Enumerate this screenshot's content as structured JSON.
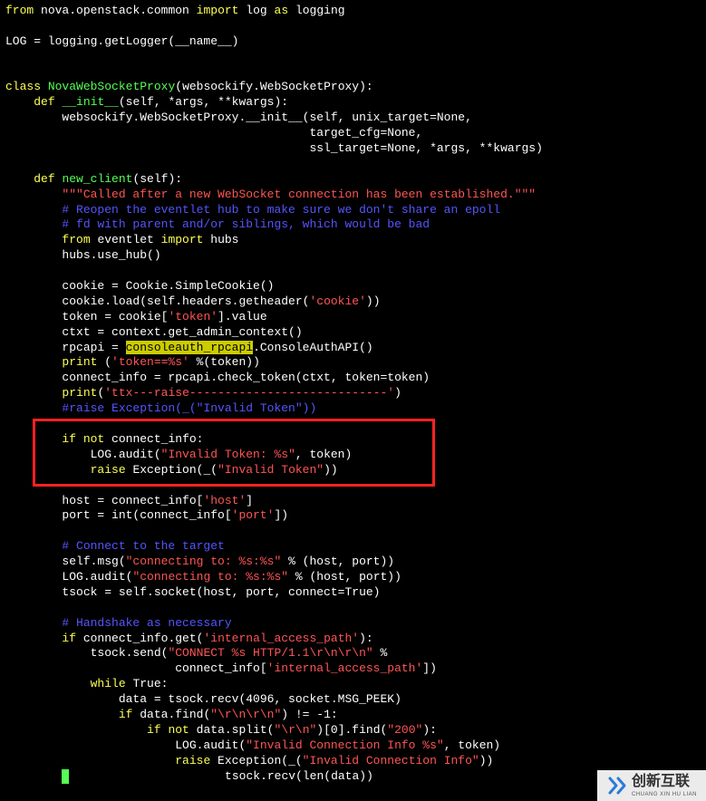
{
  "code": {
    "l1_from": "from",
    "l1_mod": "nova.openstack.common",
    "l1_import": "import",
    "l1_log": "log",
    "l1_as": "as",
    "l1_alias": "logging",
    "l3": "LOG = logging.getLogger(__name__)",
    "l6_class": "class",
    "l6_name": "NovaWebSocketProxy",
    "l6_rest": "(websockify.WebSocketProxy):",
    "l7_def": "def",
    "l7_name": "__init__",
    "l7_rest": "(self, *args, **kwargs):",
    "l8a": "        websockify.WebSocketProxy.__init__(self, unix_target=None,",
    "l8b": "                                           target_cfg=None,",
    "l8c": "                                           ssl_target=None, *args, **kwargs)",
    "l11_def": "def",
    "l11_name": "new_client",
    "l11_rest": "(self):",
    "l12_pre": "        ",
    "l12_doc": "\"\"\"Called after a new WebSocket connection has been established.\"\"\"",
    "l13": "        # Reopen the eventlet hub to make sure we don't share an epoll",
    "l14": "        # fd with parent and/or siblings, which would be bad",
    "l15_pre": "        ",
    "l15_from": "from",
    "l15_mod": " eventlet ",
    "l15_import": "import",
    "l15_rest": " hubs",
    "l16": "        hubs.use_hub()",
    "l18": "        cookie = Cookie.SimpleCookie()",
    "l19a": "        cookie.load(self.headers.getheader(",
    "l19s": "'cookie'",
    "l19b": "))",
    "l20a": "        token = cookie[",
    "l20s": "'token'",
    "l20b": "].value",
    "l21": "        ctxt = context.get_admin_context()",
    "l22a": "        rpcapi = ",
    "l22hl": "consoleauth_rpcapi",
    "l22b": ".ConsoleAuthAPI()",
    "l23_pre": "        ",
    "l23_print": "print",
    "l23a": " (",
    "l23s": "'token==%s'",
    "l23b": " %(token))",
    "l24": "        connect_info = rpcapi.check_token(ctxt, token=token)",
    "l25_pre": "        ",
    "l25_print": "print",
    "l25a": "(",
    "l25s": "'ttx---raise----------------------------'",
    "l25b": ")",
    "l26": "        #raise Exception(_(\"Invalid Token\"))",
    "l28_pre": "        ",
    "l28_if": "if",
    "l28_not": " not",
    "l28_rest": " connect_info:",
    "l29a": "            LOG.audit(",
    "l29s": "\"Invalid Token: %s\"",
    "l29b": ", token)",
    "l30_pre": "            ",
    "l30_raise": "raise",
    "l30a": " Exception(_(",
    "l30s": "\"Invalid Token\"",
    "l30b": "))",
    "l32a": "        host = connect_info[",
    "l32s": "'host'",
    "l32b": "]",
    "l33a": "        port = int(connect_info[",
    "l33s": "'port'",
    "l33b": "])",
    "l35": "        # Connect to the target",
    "l36a": "        self.msg(",
    "l36s": "\"connecting to: %s:%s\"",
    "l36b": " % (host, port))",
    "l37a": "        LOG.audit(",
    "l37s": "\"connecting to: %s:%s\"",
    "l37b": " % (host, port))",
    "l38": "        tsock = self.socket(host, port, connect=True)",
    "l40": "        # Handshake as necessary",
    "l41_pre": "        ",
    "l41_if": "if",
    "l41a": " connect_info.get(",
    "l41s": "'internal_access_path'",
    "l41b": "):",
    "l42a": "            tsock.send(",
    "l42s": "\"CONNECT %s HTTP/1.1\\r\\n\\r\\n\"",
    "l42b": " %",
    "l43a": "                        connect_info[",
    "l43s": "'internal_access_path'",
    "l43b": "])",
    "l44_pre": "            ",
    "l44_while": "while",
    "l44_rest": " True:",
    "l45": "                data = tsock.recv(4096, socket.MSG_PEEK)",
    "l46_pre": "                ",
    "l46_if": "if",
    "l46a": " data.find(",
    "l46s": "\"\\r\\n\\r\\n\"",
    "l46b": ") != -1:",
    "l47_pre": "                    ",
    "l47_if": "if",
    "l47_not": " not",
    "l47a": " data.split(",
    "l47s1": "\"\\r\\n\"",
    "l47b": ")[0].find(",
    "l47s2": "\"200\"",
    "l47c": "):",
    "l48a": "                        LOG.audit(",
    "l48s": "\"Invalid Connection Info %s\"",
    "l48b": ", token)",
    "l49_pre": "                        ",
    "l49_raise": "raise",
    "l49a": " Exception(_(",
    "l49s": "\"Invalid Connection Info\"",
    "l49b": "))",
    "l50": "                    tsock.recv(len(data))"
  },
  "watermark": {
    "zh": "创新互联",
    "en": "CHUANG XIN HU LIAN"
  }
}
